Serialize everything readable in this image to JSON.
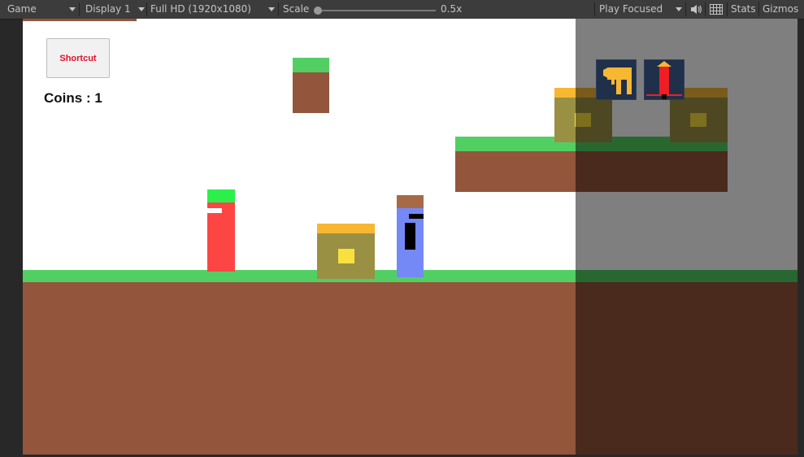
{
  "toolbar": {
    "view_label": "Game",
    "display_label": "Display 1",
    "resolution_label": "Full HD (1920x1080)",
    "scale_label": "Scale",
    "scale_value": "0.5x",
    "scale_fraction": 0.0,
    "play_mode_label": "Play Focused",
    "stats_label": "Stats",
    "gizmos_label": "Gizmos"
  },
  "hud": {
    "shortcut_label": "Shortcut",
    "coins_text": "Coins : 1"
  },
  "colors": {
    "grass": "#52cf62",
    "dirt": "#93553b",
    "chest_lid": "#f7b732",
    "chest_body": "#9a9044",
    "chest_lock": "#f8e13c",
    "player_red": "#fd4644",
    "player_red_head": "#2bf04b",
    "npc_blue": "#7589f6",
    "npc_blue_head": "#a76a47",
    "ability_bg": "#20304a",
    "ability_icon": "#f7b732",
    "ability_arrow": "#ee1e24",
    "shortcut_text": "#e0102a"
  },
  "icons": {
    "speaker": "speaker-icon",
    "stats_grid": "grid-icon",
    "dash_ability": "dash-ability-icon",
    "jump_ability": "jump-ability-icon"
  }
}
